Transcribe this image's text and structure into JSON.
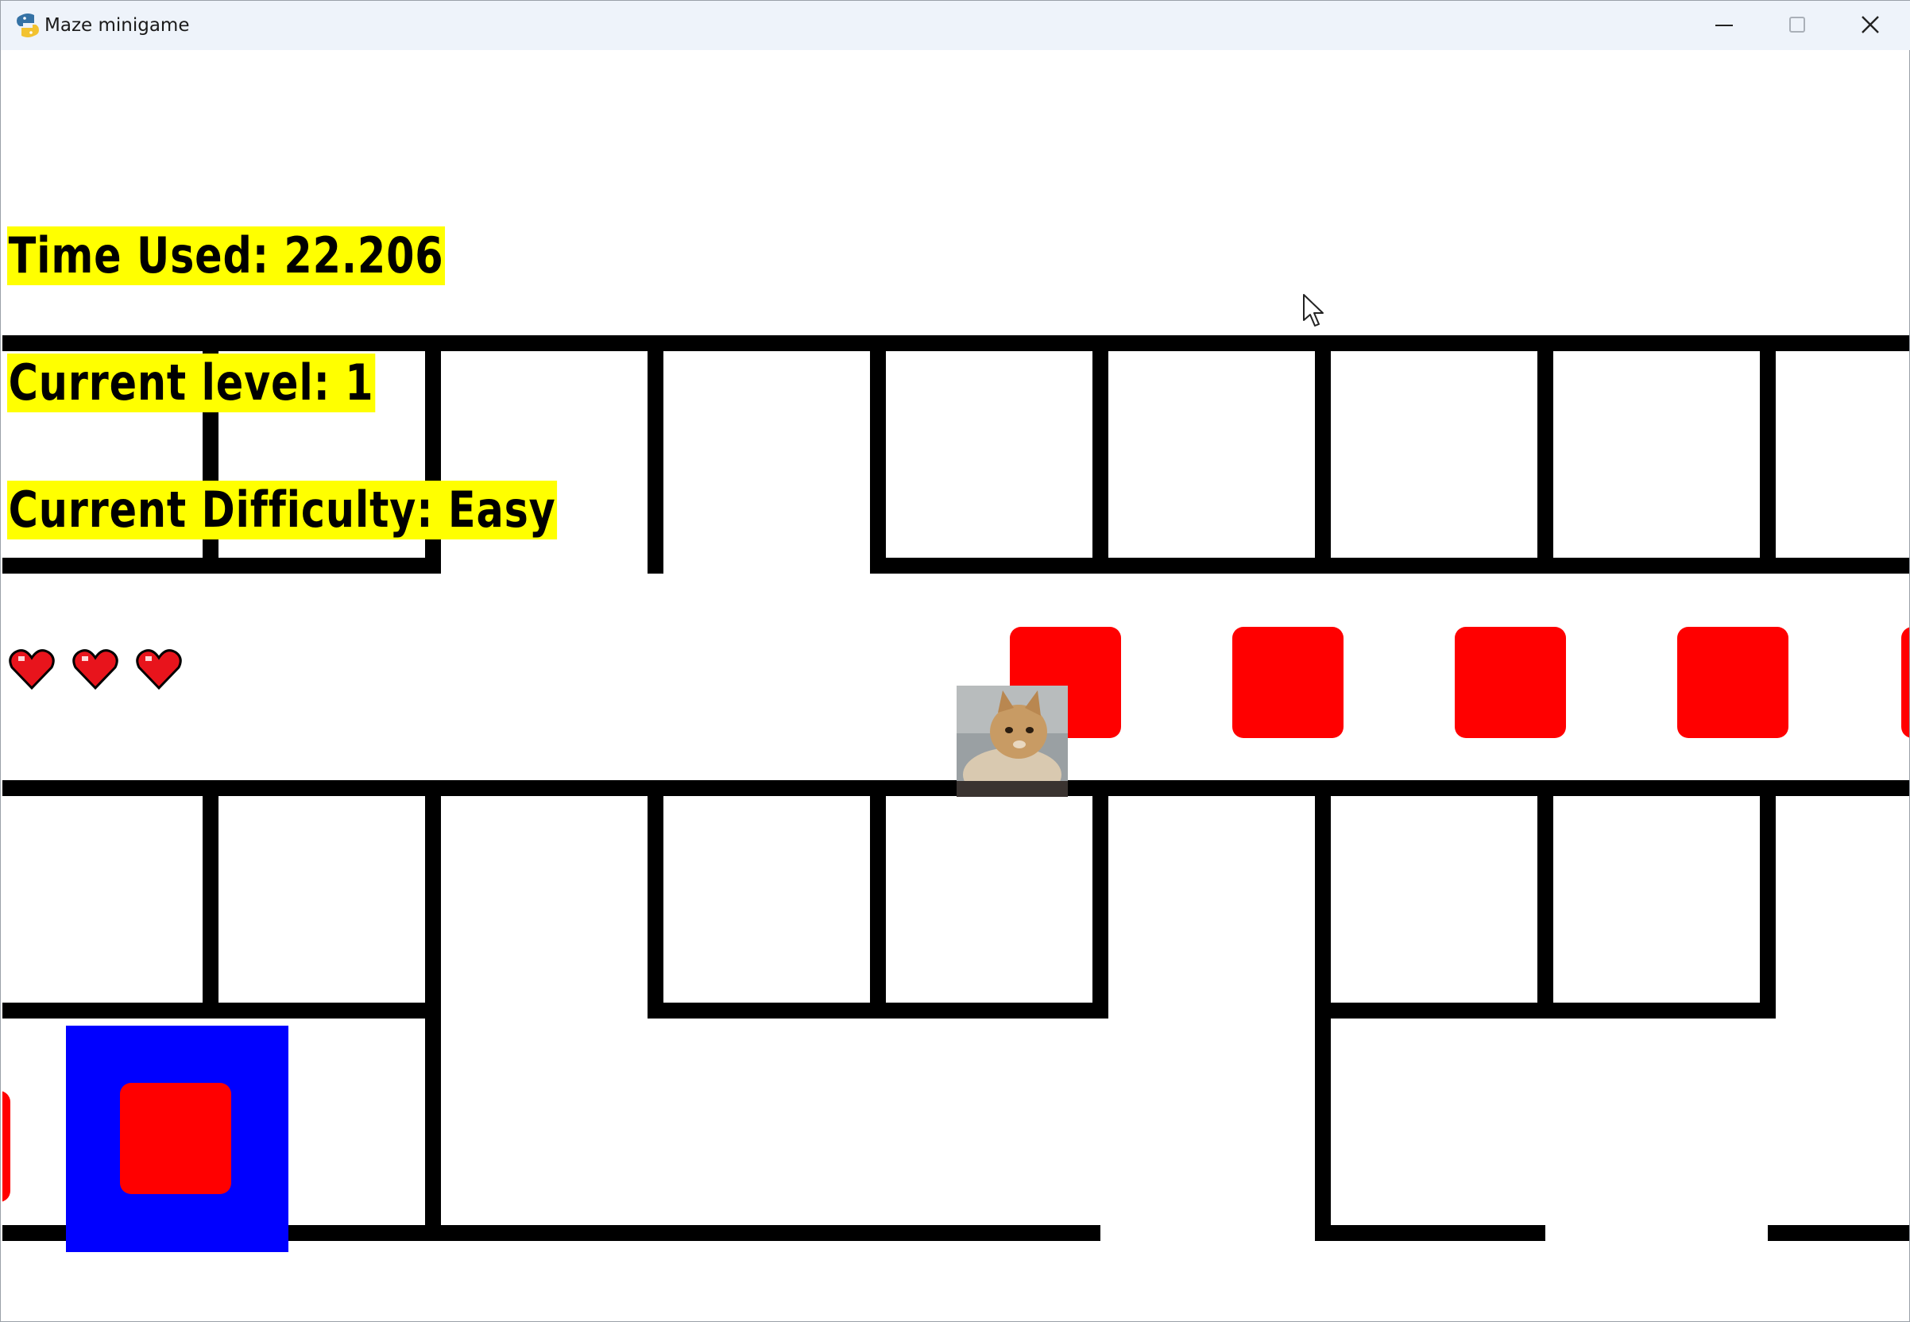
{
  "window": {
    "title": "Maze minigame",
    "app_icon": "python-pygame-icon",
    "controls": [
      "minimize-icon",
      "maximize-icon",
      "close-icon"
    ]
  },
  "hud": {
    "time_used": "Time Used: 22.206",
    "current_level": "Current level: 1",
    "current_difficulty": "Current Difficulty: Easy",
    "lives": 3,
    "life_icon": "heart-icon"
  },
  "game": {
    "player_icon": "cat-player-icon",
    "goal_tile_color": "#0000ff",
    "coin_color": "#ff0000",
    "wall_color": "#000000",
    "hud_highlight_color": "#ffff00"
  }
}
